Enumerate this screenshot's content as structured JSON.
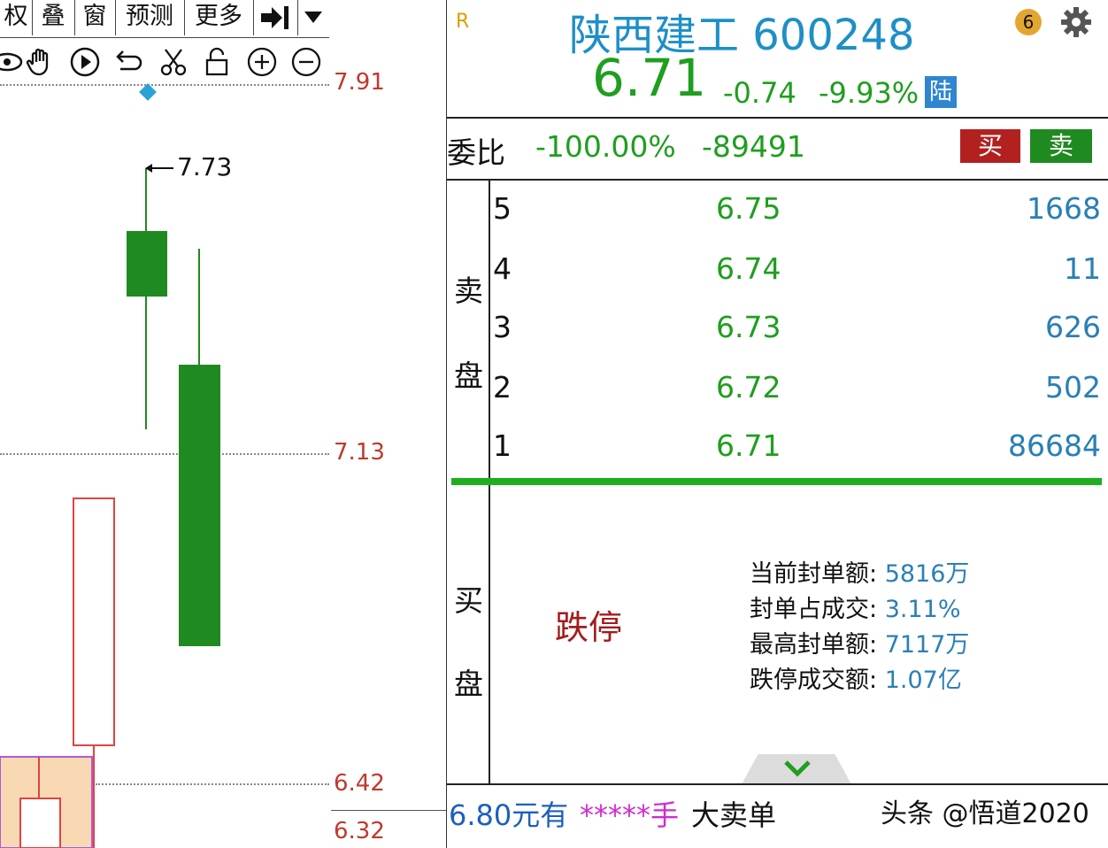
{
  "toolbar": {
    "tabs": [
      "权",
      "叠",
      "窗",
      "预测",
      "更多"
    ],
    "icons": [
      "eye-icon",
      "hand-icon",
      "play-icon",
      "undo-icon",
      "scissors-icon",
      "lock-icon",
      "zoom-in-icon",
      "zoom-out-icon"
    ]
  },
  "chart": {
    "high_marker": "7.73",
    "price_labels": [
      "7.91",
      "7.13",
      "6.42",
      "6.32"
    ]
  },
  "quote": {
    "r_badge": "R",
    "title": "陕西建工 600248",
    "price": "6.71",
    "change": "-0.74",
    "change_pct": "-9.93%",
    "market_badge": "陆",
    "notif_count": "6",
    "weibi_label": "委比",
    "weibi_pct": "-100.00%",
    "weicha": "-89491",
    "buy_label": "买",
    "sell_label": "卖"
  },
  "sell_side_label": [
    "卖",
    "盘"
  ],
  "buy_side_label": [
    "买",
    "盘"
  ],
  "asks": [
    {
      "level": "5",
      "price": "6.75",
      "volume": "1668"
    },
    {
      "level": "4",
      "price": "6.74",
      "volume": "11"
    },
    {
      "level": "3",
      "price": "6.73",
      "volume": "626"
    },
    {
      "level": "2",
      "price": "6.72",
      "volume": "502"
    },
    {
      "level": "1",
      "price": "6.71",
      "volume": "86684"
    }
  ],
  "limit_down_label": "跌停",
  "seal_stats": [
    {
      "key": "当前封单额:",
      "value": "5816万"
    },
    {
      "key": "封单占成交:",
      "value": "3.11%"
    },
    {
      "key": "最高封单额:",
      "value": "7117万"
    },
    {
      "key": "跌停成交额:",
      "value": "1.07亿"
    }
  ],
  "ticker": {
    "part1": "6.80元有",
    "part2": "*****手",
    "part3": "大卖单"
  },
  "watermark": "头条 @悟道2020"
}
